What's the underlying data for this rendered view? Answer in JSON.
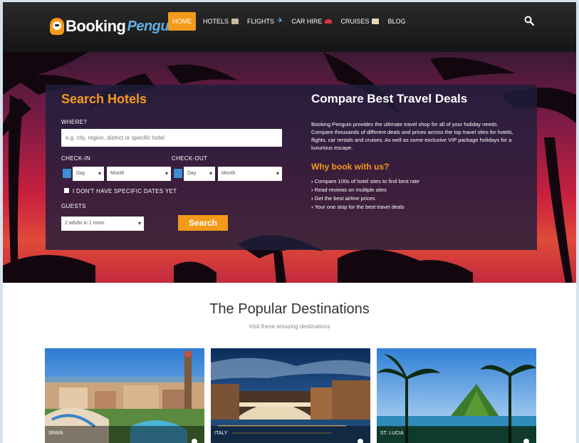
{
  "brand": {
    "part1": "Booking",
    "part2": "Penguin"
  },
  "nav": {
    "items": [
      {
        "label": "HOME",
        "icon": ""
      },
      {
        "label": "HOTELS",
        "icon": "hotel-icon"
      },
      {
        "label": "FLIGHTS",
        "icon": "plane-icon"
      },
      {
        "label": "CAR HIRE",
        "icon": "car-icon"
      },
      {
        "label": "CRUISES",
        "icon": "ship-icon"
      },
      {
        "label": "BLOG",
        "icon": ""
      }
    ],
    "search_icon": "search-icon"
  },
  "search": {
    "title": "Search Hotels",
    "where_label": "WHERE?",
    "where_placeholder": "e.g. city, region, district or specific hotel",
    "checkin_label": "CHECK-IN",
    "checkout_label": "CHECK-OUT",
    "day_placeholder": "Day",
    "month_placeholder": "Month",
    "no_dates_label": "I DON'T HAVE SPECIFIC DATES YET",
    "guests_label": "GUESTS",
    "guests_value": "2 adults in 1 room",
    "button_label": "Search"
  },
  "compare": {
    "title": "Compare Best Travel Deals",
    "text": "Booking Penguin provides the ultimate travel shop for all of your holiday needs. Compare thousands of different deals and prices across the top travel sites for hotels, flights, car rentals and cruises. As well as some exclusive VIP package holidays for a luxurious escape.",
    "why_title": "Why book with us?",
    "reasons": [
      "Compare 100s of hotel sites to find best rate",
      "Read reviews on mulitple sites",
      "Get the best airline prices",
      "Your one stop for the best travel deals"
    ]
  },
  "destinations": {
    "title": "The Popular Destinations",
    "subtitle": "Visit these amazing destinations",
    "cards": [
      {
        "name": "SPAIN"
      },
      {
        "name": "ITALY"
      },
      {
        "name": "ST. LUCIA"
      }
    ]
  },
  "colors": {
    "accent": "#f49a1a",
    "brand_blue": "#5fb0e6",
    "panel": "#1e1e3c"
  }
}
